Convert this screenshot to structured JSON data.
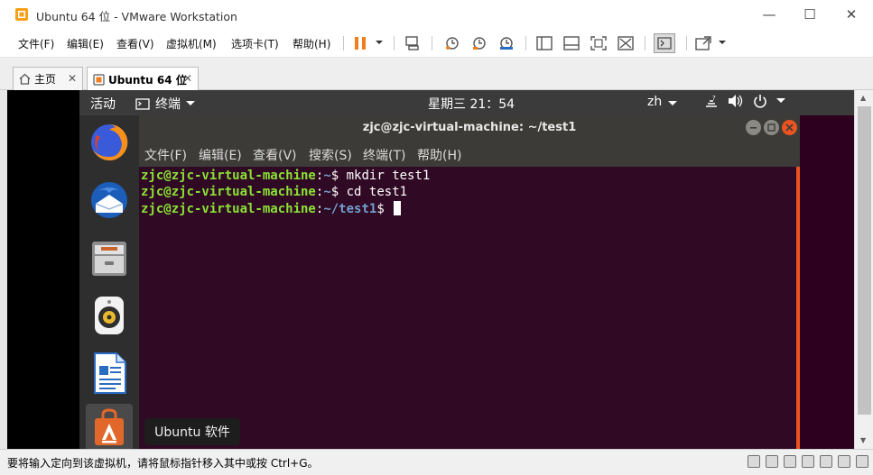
{
  "window": {
    "title": "Ubuntu 64 位 - VMware Workstation",
    "minimize": "—",
    "maximize": "☐",
    "close": "✕"
  },
  "menubar": {
    "items": [
      "文件(F)",
      "编辑(E)",
      "查看(V)",
      "虚拟机(M)",
      "选项卡(T)",
      "帮助(H)"
    ]
  },
  "toolbar": {
    "icons": [
      "pause-icon",
      "send-ctrl-alt-del-icon",
      "snapshot-icon",
      "revert-snapshot-icon",
      "snapshot-manager-icon",
      "sidebar-icon",
      "thumbnail-icon",
      "fullscreen-icon",
      "unity-icon",
      "console-icon",
      "stretch-icon"
    ],
    "accent": "#f07d1e"
  },
  "tabs": [
    {
      "label": "主页",
      "close": "✕"
    },
    {
      "label": "Ubuntu 64 位",
      "close": "✕"
    }
  ],
  "guest": {
    "topbar": {
      "activities": "活动",
      "app_menu": "终端",
      "clock": "星期三 21：54",
      "lang": "zh"
    },
    "dock": [
      "firefox-icon",
      "thunderbird-icon",
      "files-icon",
      "rhythmbox-icon",
      "writer-icon",
      "ubuntu-software-icon"
    ],
    "tooltip": "Ubuntu 软件",
    "terminal": {
      "title": "zjc@zjc-virtual-machine: ~/test1",
      "menu": [
        "文件(F)",
        "编辑(E)",
        "查看(V)",
        "搜索(S)",
        "终端(T)",
        "帮助(H)"
      ],
      "lines": [
        {
          "user": "zjc@zjc-virtual-machine",
          "path": "~",
          "cmd": " mkdir test1"
        },
        {
          "user": "zjc@zjc-virtual-machine",
          "path": "~",
          "cmd": " cd test1"
        },
        {
          "user": "zjc@zjc-virtual-machine",
          "path": "~/test1",
          "cmd": " "
        }
      ],
      "colors": {
        "bg": "#300a24",
        "user": "#8ae234",
        "path": "#729fcf",
        "accent": "#e95420"
      }
    }
  },
  "statusbar": {
    "text": "要将输入定向到该虚拟机，请将鼠标指针移入其中或按 Ctrl+G。"
  }
}
